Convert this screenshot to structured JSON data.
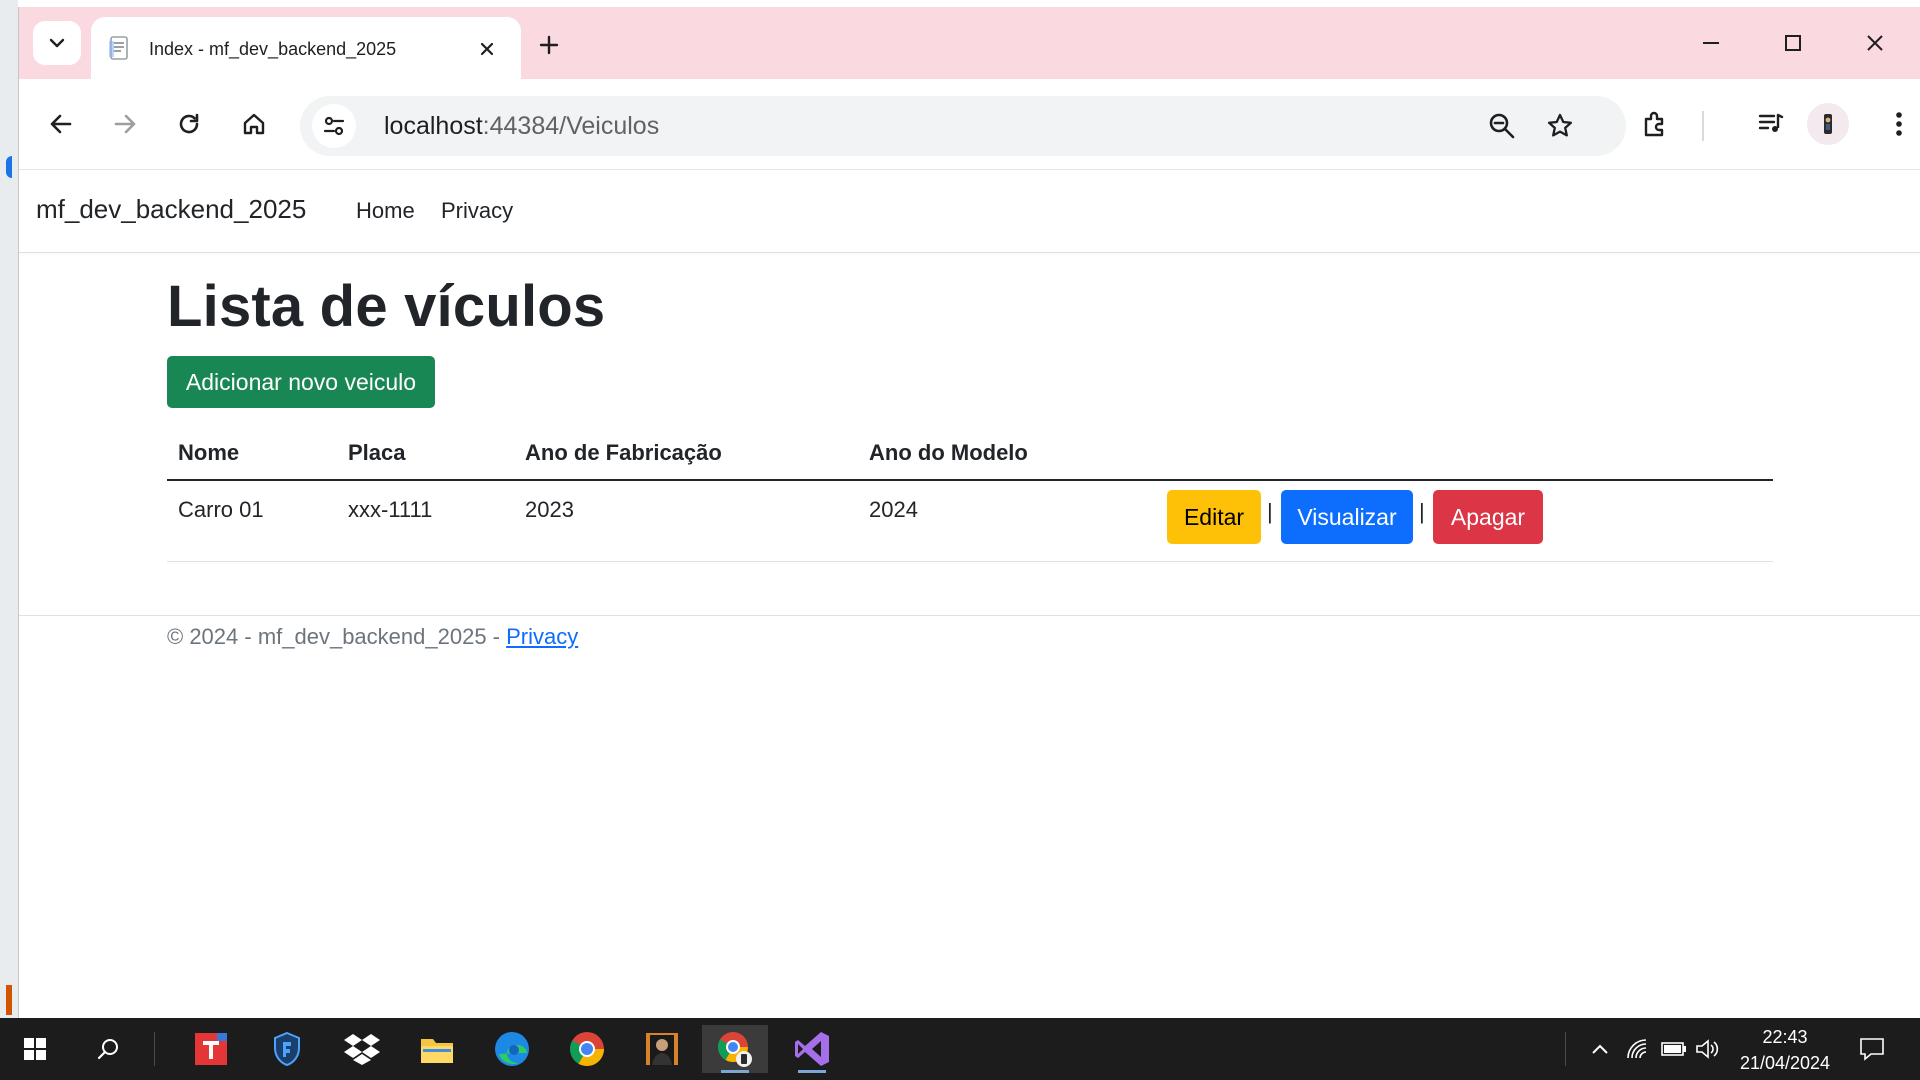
{
  "browser": {
    "tab_title": "Index - mf_dev_backend_2025",
    "url_host": "localhost",
    "url_path": ":44384/Veiculos"
  },
  "navbar": {
    "brand": "mf_dev_backend_2025",
    "links": [
      "Home",
      "Privacy"
    ]
  },
  "main": {
    "title": "Lista de vículos",
    "add_button": "Adicionar novo veiculo",
    "table": {
      "headers": [
        "Nome",
        "Placa",
        "Ano de Fabricação",
        "Ano do Modelo"
      ],
      "rows": [
        {
          "nome": "Carro 01",
          "placa": "xxx-1111",
          "ano_fabricacao": "2023",
          "ano_modelo": "2024",
          "actions": [
            "Editar",
            "Visualizar",
            "Apagar"
          ],
          "separator": "|"
        }
      ]
    }
  },
  "footer": {
    "text": "© 2024 - mf_dev_backend_2025 - ",
    "link": "Privacy"
  },
  "taskbar": {
    "time": "22:43",
    "date": "21/04/2024",
    "apps": [
      "start-icon",
      "search-icon",
      "typora-icon",
      "shield-icon",
      "dropbox-icon",
      "file-explorer-icon",
      "edge-icon",
      "chrome-icon",
      "avatar-app-icon",
      "chrome-profile-icon",
      "visual-studio-icon"
    ]
  },
  "colors": {
    "tabstrip": "#fbd9e0",
    "success": "#198754",
    "warning": "#ffc107",
    "primary": "#0d6efd",
    "danger": "#dc3545",
    "taskbar": "#1c1c1c"
  }
}
